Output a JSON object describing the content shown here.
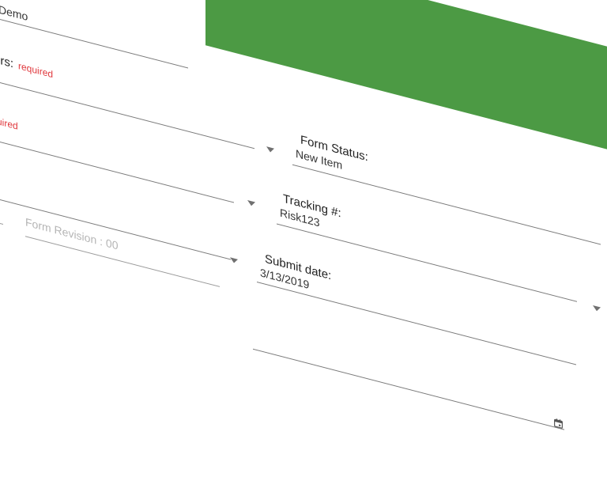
{
  "header": {
    "band_color": "#4c9a44"
  },
  "fields": {
    "demo_value": "Demo",
    "authors_label": "ors:",
    "authors_required": "required",
    "risk_required": "uired",
    "form_status_label": "Form Status:",
    "form_status_value": "New Item",
    "tracking_label": "Tracking #:",
    "tracking_value": "Risk123",
    "form_revision_placeholder": "Form Revision : 00",
    "submit_date_label": "Submit date:",
    "submit_date_value": "3/13/2019"
  },
  "icons": {
    "dropdown": "chevron-down-icon",
    "calendar": "calendar-icon"
  },
  "colors": {
    "required": "#e0393e",
    "accent": "#4c9a44"
  }
}
